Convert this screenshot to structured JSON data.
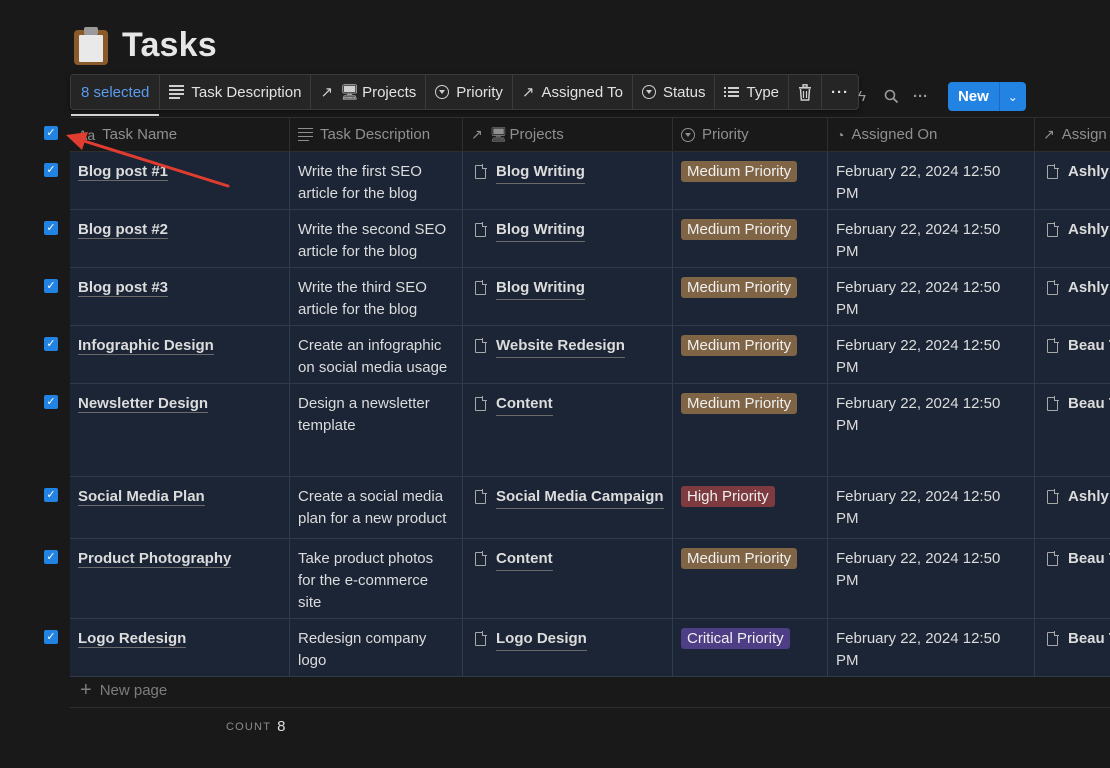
{
  "page": {
    "title": "Tasks",
    "icon": "clipboard-icon"
  },
  "toolbar": {
    "selected_label": "8 selected",
    "items": [
      {
        "label": "Task Description",
        "icon": "text-lines-icon"
      },
      {
        "label": "Projects",
        "icon": "relation-arrow-icon"
      },
      {
        "label": "Priority",
        "icon": "select-icon"
      },
      {
        "label": "Assigned To",
        "icon": "relation-arrow-icon"
      },
      {
        "label": "Status",
        "icon": "select-icon"
      },
      {
        "label": "Type",
        "icon": "list-icon"
      }
    ],
    "delete_icon": "trash-icon",
    "more_icon": "more-icon"
  },
  "view_tools": {
    "new_label": "New"
  },
  "columns": [
    {
      "label": "Task Name",
      "icon": "Aa"
    },
    {
      "label": "Task Description"
    },
    {
      "label": "Projects"
    },
    {
      "label": "Priority"
    },
    {
      "label": "Assigned On"
    },
    {
      "label": "Assign"
    }
  ],
  "rows": [
    {
      "name": "Blog post #1",
      "description": "Write the first SEO article for the blog",
      "project": "Blog Writing",
      "priority": "Medium Priority",
      "assigned_on": "February 22, 2024 12:50 PM",
      "assigned_to": "Ashly"
    },
    {
      "name": "Blog post #2",
      "description": "Write the second SEO article for the blog",
      "project": "Blog Writing",
      "priority": "Medium Priority",
      "assigned_on": "February 22, 2024 12:50 PM",
      "assigned_to": "Ashly"
    },
    {
      "name": "Blog post #3",
      "description": "Write the third SEO article for the blog",
      "project": "Blog Writing",
      "priority": "Medium Priority",
      "assigned_on": "February 22, 2024 12:50 PM",
      "assigned_to": "Ashly"
    },
    {
      "name": "Infographic Design",
      "description": "Create an infographic on social media usage",
      "project": "Website Redesign",
      "priority": "Medium Priority",
      "assigned_on": "February 22, 2024 12:50 PM",
      "assigned_to": "Beau T"
    },
    {
      "name": "Newsletter Design",
      "description": "Design a newsletter template",
      "project": "Content",
      "priority": "Medium Priority",
      "assigned_on": "February 22, 2024 12:50 PM",
      "assigned_to": "Beau T"
    },
    {
      "name": "Social Media Plan",
      "description": "Create a social media plan for a new product",
      "project": "Social Media Campaign",
      "priority": "High Priority",
      "assigned_on": "February 22, 2024 12:50 PM",
      "assigned_to": "Ashly"
    },
    {
      "name": "Product Photography",
      "description": "Take product photos for the e-commerce site",
      "project": "Content",
      "priority": "Medium Priority",
      "assigned_on": "February 22, 2024 12:50 PM",
      "assigned_to": "Beau T"
    },
    {
      "name": "Logo Redesign",
      "description": "Redesign company logo",
      "project": "Logo Design",
      "priority": "Critical Priority",
      "assigned_on": "February 22, 2024 12:50 PM",
      "assigned_to": "Beau T"
    }
  ],
  "footer": {
    "new_page_label": "New page",
    "count_label": "COUNT",
    "count_value": "8"
  },
  "colors": {
    "selection_blue": "#2383e2",
    "medium": "#7f6445",
    "high": "#7d3a3f",
    "critical": "#4e3e85",
    "annotation_arrow": "#e03c2f"
  }
}
